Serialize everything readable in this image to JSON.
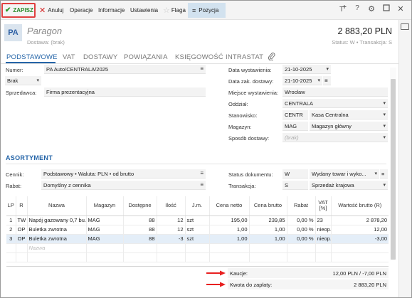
{
  "toolbar": {
    "save": "ZAPISZ",
    "cancel": "Anuluj",
    "operations": "Operacje",
    "info": "Informacje",
    "settings": "Ustawienia",
    "flag": "Flaga",
    "position": "Pozycja"
  },
  "header": {
    "badge": "PA",
    "title": "Paragon",
    "delivery": "Dostawa: (brak)",
    "amount": "2 883,20 PLN",
    "status": "Status: W  •  Transakcja: S"
  },
  "tabs": [
    "PODSTAWOWE",
    "VAT",
    "DOSTAWY",
    "POWIĄZANIA",
    "KSIĘGOWOŚĆ",
    "INTRASTAT"
  ],
  "form_left": {
    "number_label": "Numer:",
    "number_value": "PA Auto/CENTRALA/2025",
    "brak_value": "Brak",
    "seller_label": "Sprzedawca:",
    "seller_value": "Firma prezentacyjna"
  },
  "form_right": {
    "issue_date_label": "Data wystawienia:",
    "issue_date": "21-10-2025",
    "delivery_date_label": "Data zak. dostawy:",
    "delivery_date": "21-10-2025",
    "place_label": "Miejsce wystawienia:",
    "place": "Wrocław",
    "branch_label": "Oddział:",
    "branch": "CENTRALA",
    "station_label": "Stanowisko:",
    "station_code": "CENTR",
    "station_name": "Kasa Centralna",
    "warehouse_label": "Magazyn:",
    "warehouse_code": "MAG",
    "warehouse_name": "Magazyn główny",
    "shipping_label": "Sposób dostawy:",
    "shipping_placeholder": "(brak)"
  },
  "section": {
    "title": "ASORTYMENT",
    "pricelist_label": "Cennik:",
    "pricelist_value": "Podstawowy • Waluta: PLN • od brutto",
    "discount_label": "Rabat:",
    "discount_value": "Domyślny z cennika",
    "doc_status_label": "Status dokumentu:",
    "doc_status_code": "W",
    "doc_status_name": "Wydany towar i wyko...",
    "transaction_label": "Transakcja:",
    "transaction_code": "S",
    "transaction_name": "Sprzedaż krajowa"
  },
  "table": {
    "headers": [
      "LP",
      "R",
      "Nazwa",
      "Magazyn",
      "Dostępne",
      "Ilość",
      "J.m.",
      "Cena netto",
      "Cena brutto",
      "Rabat",
      "VAT [%]",
      "Wartość brutto (R)"
    ],
    "rows": [
      [
        "1",
        "TW",
        "Napój gazowany 0,7 bu...",
        "MAG",
        "88",
        "12",
        "szt",
        "195,00",
        "239,85",
        "0,00 %",
        "23",
        "2 878,20"
      ],
      [
        "2",
        "OP",
        "Buletka zwrotna",
        "MAG",
        "88",
        "12",
        "szt",
        "1,00",
        "1,00",
        "0,00 %",
        "nieop.",
        "12,00"
      ],
      [
        "3",
        "OP",
        "Buletka zwrotna",
        "MAG",
        "88",
        "-3",
        "szt",
        "1,00",
        "1,00",
        "0,00 %",
        "nieop.",
        "-3,00"
      ]
    ],
    "new_row_placeholder": "Nazwa"
  },
  "summary": {
    "deposits_label": "Kaucje:",
    "deposits_value": "12,00 PLN / -7,00 PLN",
    "total_label": "Kwota do zapłaty:",
    "total_value": "2 883,20 PLN"
  },
  "colors": {
    "accent": "#2565a8",
    "save_green": "#2a8a2a",
    "highlight_red": "#e04040",
    "selected_row": "#e4eef8"
  }
}
